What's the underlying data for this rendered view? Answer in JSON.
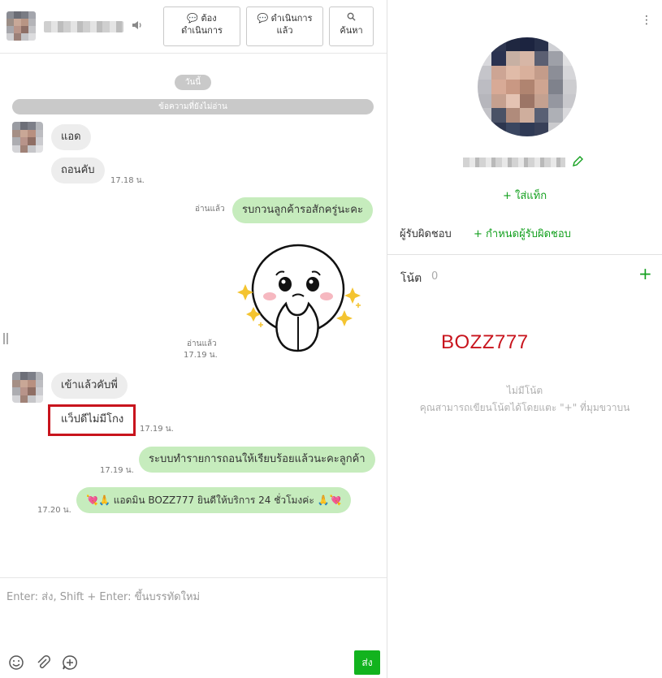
{
  "header": {
    "btn_todo_icon": "chat-bubble-icon",
    "btn_todo_line1": "ต้อง",
    "btn_todo_line2": "ดำเนินการ",
    "btn_done_line1": "ดำเนินการ",
    "btn_done_line2": "แล้ว",
    "btn_search_label": "ค้นหา"
  },
  "chat": {
    "date_pill": "วันนี้",
    "unread_pill": "ข้อความที่ยังไม่อ่าน",
    "messages": [
      {
        "text": "แอด"
      },
      {
        "text": "ถอนคับ",
        "time": "17.18 น."
      },
      {
        "text": "รบกวนลูกค้ารอสักครู่นะคะ",
        "read": "อ่านแล้ว"
      },
      {
        "sticker": "sticker-face-praying",
        "read": "อ่านแล้ว",
        "time": "17.19 น."
      },
      {
        "text": "เข้าแล้วคับพี่"
      },
      {
        "text": "แว็ปดีไม่มีโกง",
        "time": "17.19 น."
      },
      {
        "text": "ระบบทำรายการถอนให้เรียบร้อยแล้วนะคะลูกค้า",
        "time": "17.19 น."
      },
      {
        "text": "💘🙏 แอดมิน BOZZ777 ยินดีให้บริการ 24 ชั่วโมงค่ะ 🙏💘",
        "time": "17.20 น."
      }
    ]
  },
  "composer": {
    "placeholder": "Enter: ส่ง, Shift + Enter: ขึ้นบรรทัดใหม่",
    "send_label": "ส่ง"
  },
  "profile": {
    "add_tag": "+ ใส่แท็ก",
    "owner_label": "ผู้รับผิดชอบ",
    "owner_set": "+ กำหนดผู้รับผิดชอบ",
    "notes_label": "โน้ต",
    "notes_count": "0",
    "notes_add": "+",
    "watermark": "BOZZ777",
    "empty_title": "ไม่มีโน้ต",
    "empty_desc": "คุณสามารถเขียนโน้ตได้โดยแตะ \"+\" ที่มุมขวาบน"
  },
  "colors": {
    "accent": "#13a01e",
    "send": "#12b31e",
    "outgoing_bubble": "#c6ecbd",
    "incoming_bubble": "#ededed",
    "highlight": "#c8141d"
  }
}
